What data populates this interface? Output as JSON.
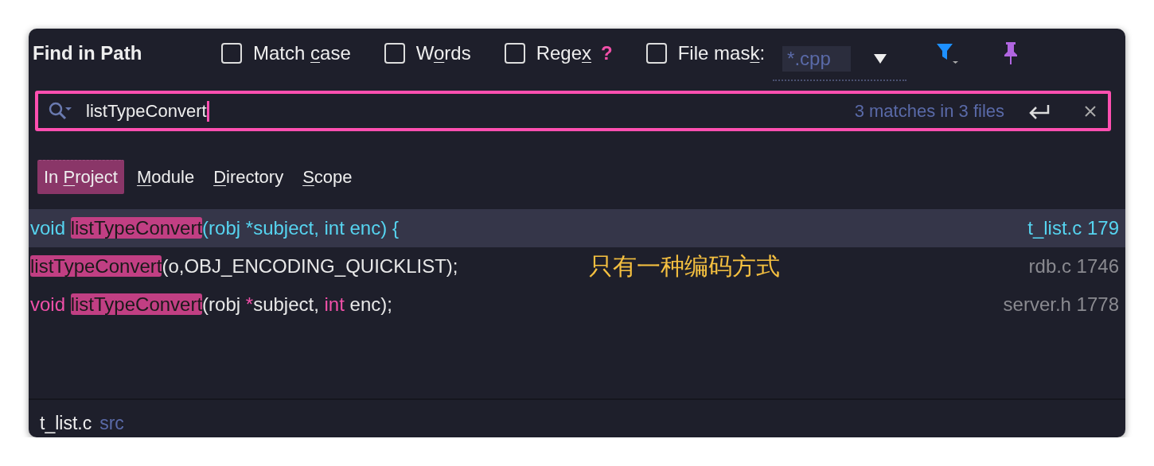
{
  "window": {
    "title": "Find in Path"
  },
  "options": [
    {
      "parts": [
        {
          "text": "Match ",
          "mnemonic": false
        },
        {
          "text": "c",
          "mnemonic": true
        },
        {
          "text": "ase",
          "mnemonic": false
        }
      ],
      "checked": false
    },
    {
      "parts": [
        {
          "text": "W",
          "mnemonic": false
        },
        {
          "text": "o",
          "mnemonic": true
        },
        {
          "text": "rds",
          "mnemonic": false
        }
      ],
      "checked": false
    },
    {
      "parts": [
        {
          "text": "Rege",
          "mnemonic": false
        },
        {
          "text": "x",
          "mnemonic": true
        }
      ],
      "checked": false,
      "help": "?"
    },
    {
      "parts": [
        {
          "text": "File mas",
          "mnemonic": false
        },
        {
          "text": "k",
          "mnemonic": true
        },
        {
          "text": ":",
          "mnemonic": false
        }
      ],
      "checked": false
    }
  ],
  "file_mask": {
    "value": "*.cpp"
  },
  "search": {
    "value": "listTypeConvert",
    "match_count": "3 matches in 3 files"
  },
  "scopes": [
    {
      "parts": [
        {
          "text": "In ",
          "mnemonic": false
        },
        {
          "text": "P",
          "mnemonic": true
        },
        {
          "text": "roject",
          "mnemonic": false
        }
      ],
      "selected": true
    },
    {
      "parts": [
        {
          "text": "M",
          "mnemonic": true
        },
        {
          "text": "odule",
          "mnemonic": false
        }
      ],
      "selected": false
    },
    {
      "parts": [
        {
          "text": "D",
          "mnemonic": true
        },
        {
          "text": "irectory",
          "mnemonic": false
        }
      ],
      "selected": false
    },
    {
      "parts": [
        {
          "text": "S",
          "mnemonic": true
        },
        {
          "text": "cope",
          "mnemonic": false
        }
      ],
      "selected": false
    }
  ],
  "results": [
    {
      "selected": true,
      "segments": [
        {
          "kind": "plain",
          "text": "void "
        },
        {
          "kind": "match",
          "text": "listTypeConvert"
        },
        {
          "kind": "plain",
          "text": "(robj *subject, int enc) {"
        }
      ],
      "location": "t_list.c 179"
    },
    {
      "selected": false,
      "segments": [
        {
          "kind": "match",
          "text": "listTypeConvert"
        },
        {
          "kind": "plain",
          "text": "(o,OBJ_ENCODING_QUICKLIST);"
        }
      ],
      "location": "rdb.c 1746"
    },
    {
      "selected": false,
      "segments": [
        {
          "kind": "keyword",
          "text": "void "
        },
        {
          "kind": "match",
          "text": "listTypeConvert"
        },
        {
          "kind": "plain",
          "text": "(robj "
        },
        {
          "kind": "keyword",
          "text": "*"
        },
        {
          "kind": "plain",
          "text": "subject, "
        },
        {
          "kind": "keyword",
          "text": "int"
        },
        {
          "kind": "plain",
          "text": " enc);"
        }
      ],
      "location": "server.h 1778"
    }
  ],
  "annotation": "只有一种编码方式",
  "preview": {
    "file": "t_list.c",
    "dir": "src"
  }
}
